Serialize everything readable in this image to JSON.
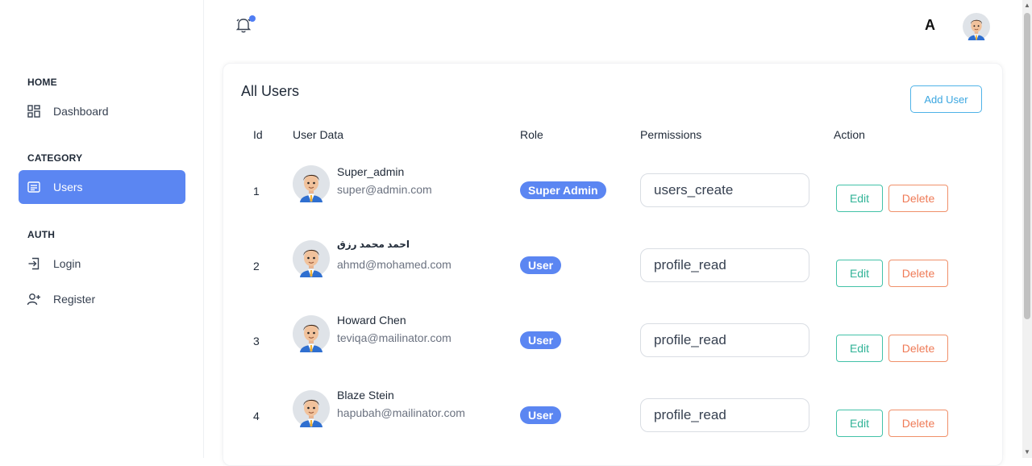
{
  "sidebar": {
    "sections": [
      {
        "title": "HOME",
        "items": [
          {
            "label": "Dashboard",
            "icon": "dashboard-icon"
          }
        ]
      },
      {
        "title": "CATEGORY",
        "items": [
          {
            "label": "Users",
            "icon": "list-icon",
            "active": true
          }
        ]
      },
      {
        "title": "AUTH",
        "items": [
          {
            "label": "Login",
            "icon": "login-icon"
          },
          {
            "label": "Register",
            "icon": "user-plus-icon"
          }
        ]
      }
    ]
  },
  "topbar": {
    "language_letter": "A",
    "notification_icon": "bell-icon",
    "accent": "#4f7df3"
  },
  "users": {
    "title": "All Users",
    "add_label": "Add User",
    "headers": {
      "id": "Id",
      "user_data": "User Data",
      "role": "Role",
      "permissions": "Permissions",
      "action": "Action"
    },
    "rows": [
      {
        "id": "1",
        "name": "Super_admin",
        "email": "super@admin.com",
        "role": "Super Admin",
        "permission": "users_create",
        "edit": "Edit",
        "delete": "Delete"
      },
      {
        "id": "2",
        "name": "احمد محمد رزق",
        "email": "ahmd@mohamed.com",
        "role": "User",
        "permission": "profile_read",
        "edit": "Edit",
        "delete": "Delete"
      },
      {
        "id": "3",
        "name": "Howard Chen",
        "email": "teviqa@mailinator.com",
        "role": "User",
        "permission": "profile_read",
        "edit": "Edit",
        "delete": "Delete"
      },
      {
        "id": "4",
        "name": "Blaze Stein",
        "email": "hapubah@mailinator.com",
        "role": "User",
        "permission": "profile_read",
        "edit": "Edit",
        "delete": "Delete"
      }
    ]
  },
  "colors": {
    "primary": "#5b86f2",
    "edit": "#30b397",
    "delete": "#ef7a56",
    "add": "#3aa6e0"
  }
}
